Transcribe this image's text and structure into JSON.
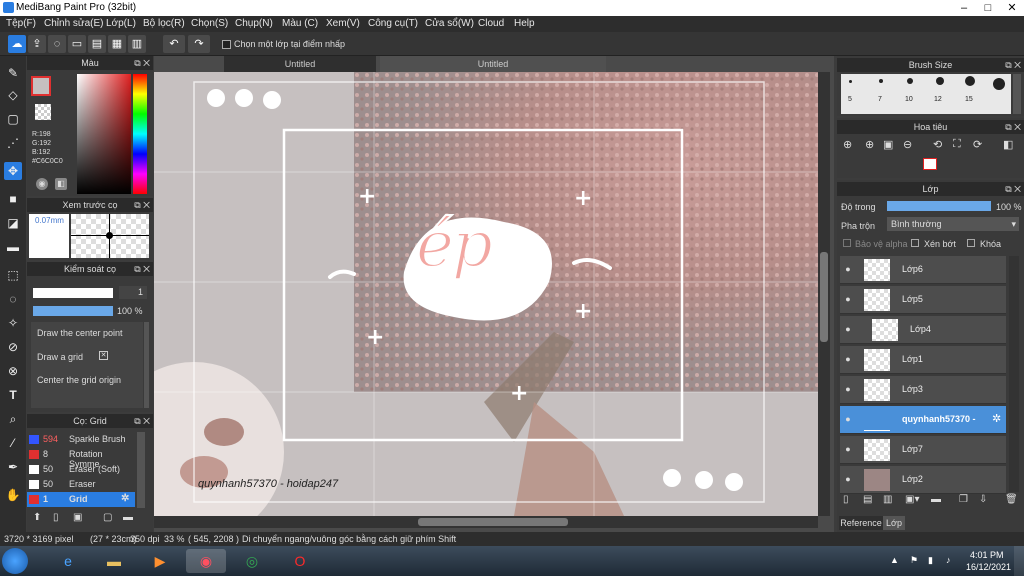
{
  "window": {
    "title": "MediBang Paint Pro (32bit)"
  },
  "menu": [
    "Tệp(F)",
    "Chỉnh sửa(E)",
    "Lớp(L)",
    "Bộ lọc(R)",
    "Chọn(S)",
    "Chụp(N)",
    "Màu (C)",
    "Xem(V)",
    "Công cụ(T)",
    "Cửa sổ(W)",
    "Cloud",
    "Help"
  ],
  "toolbar": {
    "checkbox_label": "Chọn một lớp tại điểm nhấp"
  },
  "color_panel": {
    "title": "Màu",
    "r": "R:198",
    "g": "G:192",
    "b": "B:192",
    "hex": "#C6C0C0",
    "current_color": "#c6c0c0"
  },
  "preview_panel": {
    "title": "Xem trước cọ",
    "size": "0.07mm"
  },
  "brush_control": {
    "title": "Kiểm soát cọ",
    "size_value": "1",
    "opacity_value": "100 %",
    "options": [
      "Draw the center point",
      "Draw a grid",
      "Center the grid origin"
    ]
  },
  "brush_list": {
    "title": "Cọ: Grid",
    "items": [
      {
        "size": "594",
        "name": "Sparkle Brush",
        "color": "#3355ff"
      },
      {
        "size": "8",
        "name": "Rotation Symme",
        "color": "#e03030"
      },
      {
        "size": "50",
        "name": "Eraser (Soft)",
        "color": "#ffffff"
      },
      {
        "size": "50",
        "name": "Eraser",
        "color": "#ffffff"
      },
      {
        "size": "1",
        "name": "Grid",
        "color": "#e03030"
      }
    ]
  },
  "tabs": [
    "Untitled",
    "Untitled"
  ],
  "canvas": {
    "sticker_text": "ép",
    "watermark": "quynhanh57370 - hoidap247"
  },
  "brush_size": {
    "title": "Brush Size",
    "sizes": [
      "5",
      "7",
      "10",
      "12",
      "15"
    ]
  },
  "navigator": {
    "title": "Hoa tiêu"
  },
  "layers": {
    "title": "Lớp",
    "opacity_label": "Độ trong",
    "opacity_value": "100 %",
    "blend_label": "Pha trộn",
    "blend_value": "Bình thường",
    "protect_alpha": "Bảo vệ alpha",
    "clipping": "Xén bớt",
    "lock": "Khóa",
    "items": [
      "Lớp6",
      "Lớp5",
      "Lớp4",
      "Lớp1",
      "Lớp3",
      "quynhanh57370 -",
      "Lớp7",
      "Lớp2"
    ],
    "bottom_tabs": [
      "Reference",
      "Lớp"
    ]
  },
  "status": {
    "dims": "3720 * 3169 pixel",
    "cm": "(27 * 23cm)",
    "dpi": "350 dpi",
    "zoom": "33 %",
    "coords": "( 545, 2208 )",
    "hint": "Di chuyển ngang/vuông góc bằng cách giữ phím Shift"
  },
  "taskbar": {
    "time": "4:01 PM",
    "date": "16/12/2021"
  }
}
